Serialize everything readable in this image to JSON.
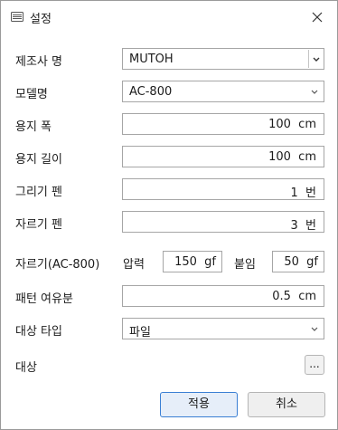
{
  "dialog": {
    "title": "설정",
    "icons": {
      "app": "window-icon",
      "close": "close-icon"
    }
  },
  "form": {
    "manufacturer": {
      "label": "제조사 명",
      "value": "MUTOH"
    },
    "model": {
      "label": "모델명",
      "value": "AC-800"
    },
    "paper_width": {
      "label": "용지 폭",
      "value": "100  cm"
    },
    "paper_length": {
      "label": "용지 길이",
      "value": "100  cm"
    },
    "draw_pen": {
      "label": "그리기 펜",
      "value": "1  번"
    },
    "cut_pen": {
      "label": "자르기 펜",
      "value": "3  번"
    },
    "cut_settings": {
      "label": "자르기(AC-800)",
      "pressure_label": "압력",
      "pressure_value": "150  gf",
      "adhesion_label": "붙임",
      "adhesion_value": "50  gf"
    },
    "pattern_margin": {
      "label": "패턴 여유분",
      "value": "0.5  cm"
    },
    "target_type": {
      "label": "대상 타입",
      "value": "파일"
    },
    "target": {
      "label": "대상",
      "browse_label": "..."
    }
  },
  "buttons": {
    "apply": "적용",
    "cancel": "취소"
  }
}
